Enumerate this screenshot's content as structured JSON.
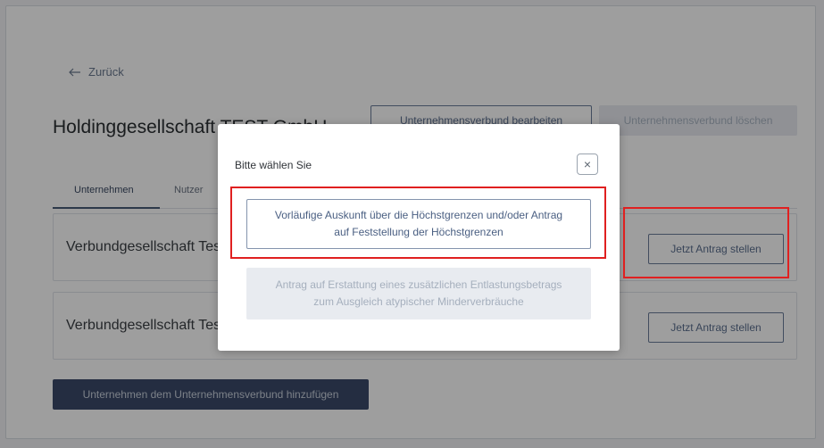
{
  "page": {
    "back_label": "Zurück",
    "company_title": "Holdinggesellschaft TEST GmbH",
    "edit_group_button": "Unternehmensverbund bearbeiten",
    "delete_group_button": "Unternehmensverbund löschen",
    "tabs": [
      {
        "label": "Unternehmen",
        "active": true
      },
      {
        "label": "Nutzer",
        "active": false
      }
    ],
    "companies": [
      {
        "name": "Verbundgesellschaft Test",
        "action": "Jetzt Antrag stellen"
      },
      {
        "name": "Verbundgesellschaft Test",
        "action": "Jetzt Antrag stellen"
      }
    ],
    "add_company_button": "Unternehmen dem Unternehmensverbund hinzufügen"
  },
  "modal": {
    "title": "Bitte wählen Sie",
    "close_symbol": "×",
    "option_primary": "Vorläufige Auskunft über die Höchstgrenzen und/oder Antrag auf Feststellung der Höchstgrenzen",
    "option_disabled": "Antrag auf Erstattung eines zusätzlichen Entlastungsbetrags zum Ausgleich atypischer Minderverbräuche"
  },
  "colors": {
    "highlight": "#e02020",
    "primary_dark": "#3a4a6a",
    "accent_text": "#4a5f82"
  }
}
